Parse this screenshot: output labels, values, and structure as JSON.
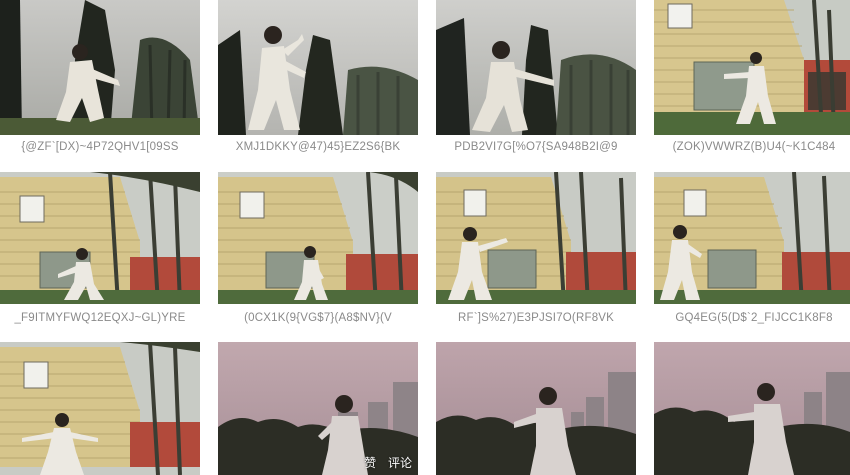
{
  "tiles": [
    {
      "caption": "{@ZF`[DX)~4P72QHV1[09SS",
      "scene": "garden-dark"
    },
    {
      "caption": "XMJ1DKKY@47)45}EZ2S6{BK",
      "scene": "garden-dark"
    },
    {
      "caption": "PDB2VI7G[%O7{SA948B2I@9",
      "scene": "garden-dark"
    },
    {
      "caption": "(ZOK)VWWRZ(B)U4(~K1C484",
      "scene": "house"
    },
    {
      "caption": "_F9ITMYFWQ12EQXJ~GL)YRE",
      "scene": "house"
    },
    {
      "caption": "(0CX1K(9{VG$7}(A8$NV}(V",
      "scene": "house"
    },
    {
      "caption": "RF`]S%27)E3PJSI7O(RF8VK",
      "scene": "house"
    },
    {
      "caption": "GQ4EG(5(D$`2_FIJCC1K8F8",
      "scene": "house"
    },
    {
      "caption": "",
      "scene": "house"
    },
    {
      "caption": "",
      "scene": "dusk"
    },
    {
      "caption": "",
      "scene": "dusk"
    },
    {
      "caption": "",
      "scene": "dusk"
    }
  ],
  "overlay": {
    "like": "赞",
    "comment": "评论"
  },
  "colors": {
    "caption": "#8a8a8a",
    "background": "#ffffff"
  },
  "icons": [
    "tai-chi-photo"
  ]
}
